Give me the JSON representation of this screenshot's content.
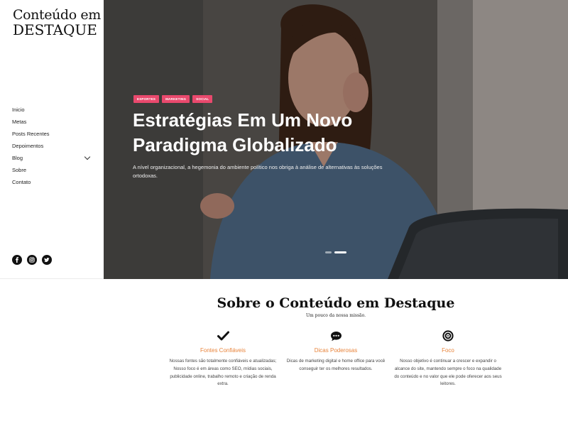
{
  "logo": {
    "line1": "Conteúdo em",
    "line2": "DESTAQUE"
  },
  "nav": {
    "items": [
      {
        "label": "Inicio"
      },
      {
        "label": "Metas"
      },
      {
        "label": "Posts Recentes"
      },
      {
        "label": "Depoimentos"
      },
      {
        "label": "Blog",
        "has_submenu": true
      },
      {
        "label": "Sobre"
      },
      {
        "label": "Contato"
      }
    ]
  },
  "social": {
    "icons": [
      "facebook-icon",
      "instagram-icon",
      "twitter-icon"
    ]
  },
  "hero": {
    "tags": [
      "ESPORTES",
      "MARKETING",
      "SOCIAL"
    ],
    "title_line1": "Estratégias Em Um Novo",
    "title_line2": "Paradigma Globalizado",
    "description": "A nível organizacional, a hegemonia do ambiente político nos obriga à análise de alternativas às soluções ortodoxas.",
    "slider": {
      "slides": 2,
      "active": 2
    }
  },
  "about": {
    "title": "Sobre o Conteúdo em Destaque",
    "subtitle": "Um pouco da nossa missão.",
    "features": [
      {
        "icon": "check-icon",
        "title": "Fontes Confiáveis",
        "text": "Nossas fontes são totalmente confiáveis e atualizadas; Nosso foco é em áreas como SEO, mídias sociais, publicidade online, trabalho remoto e criação de renda extra."
      },
      {
        "icon": "chat-bubble-icon",
        "title": "Dicas Poderosas",
        "text": "Dicas de marketing digital e home office para você conseguir ter os melhores resultados."
      },
      {
        "icon": "target-icon",
        "title": "Foco",
        "text": "Nosso objetivo é continuar a crescer e expandir o alcance do site, mantendo sempre o foco na qualidade do conteúdo e no valor que ele pode oferecer aos seus leitores."
      }
    ]
  },
  "colors": {
    "tag": "#e9496d",
    "feature_title": "#e8833a",
    "dark": "#111111"
  }
}
